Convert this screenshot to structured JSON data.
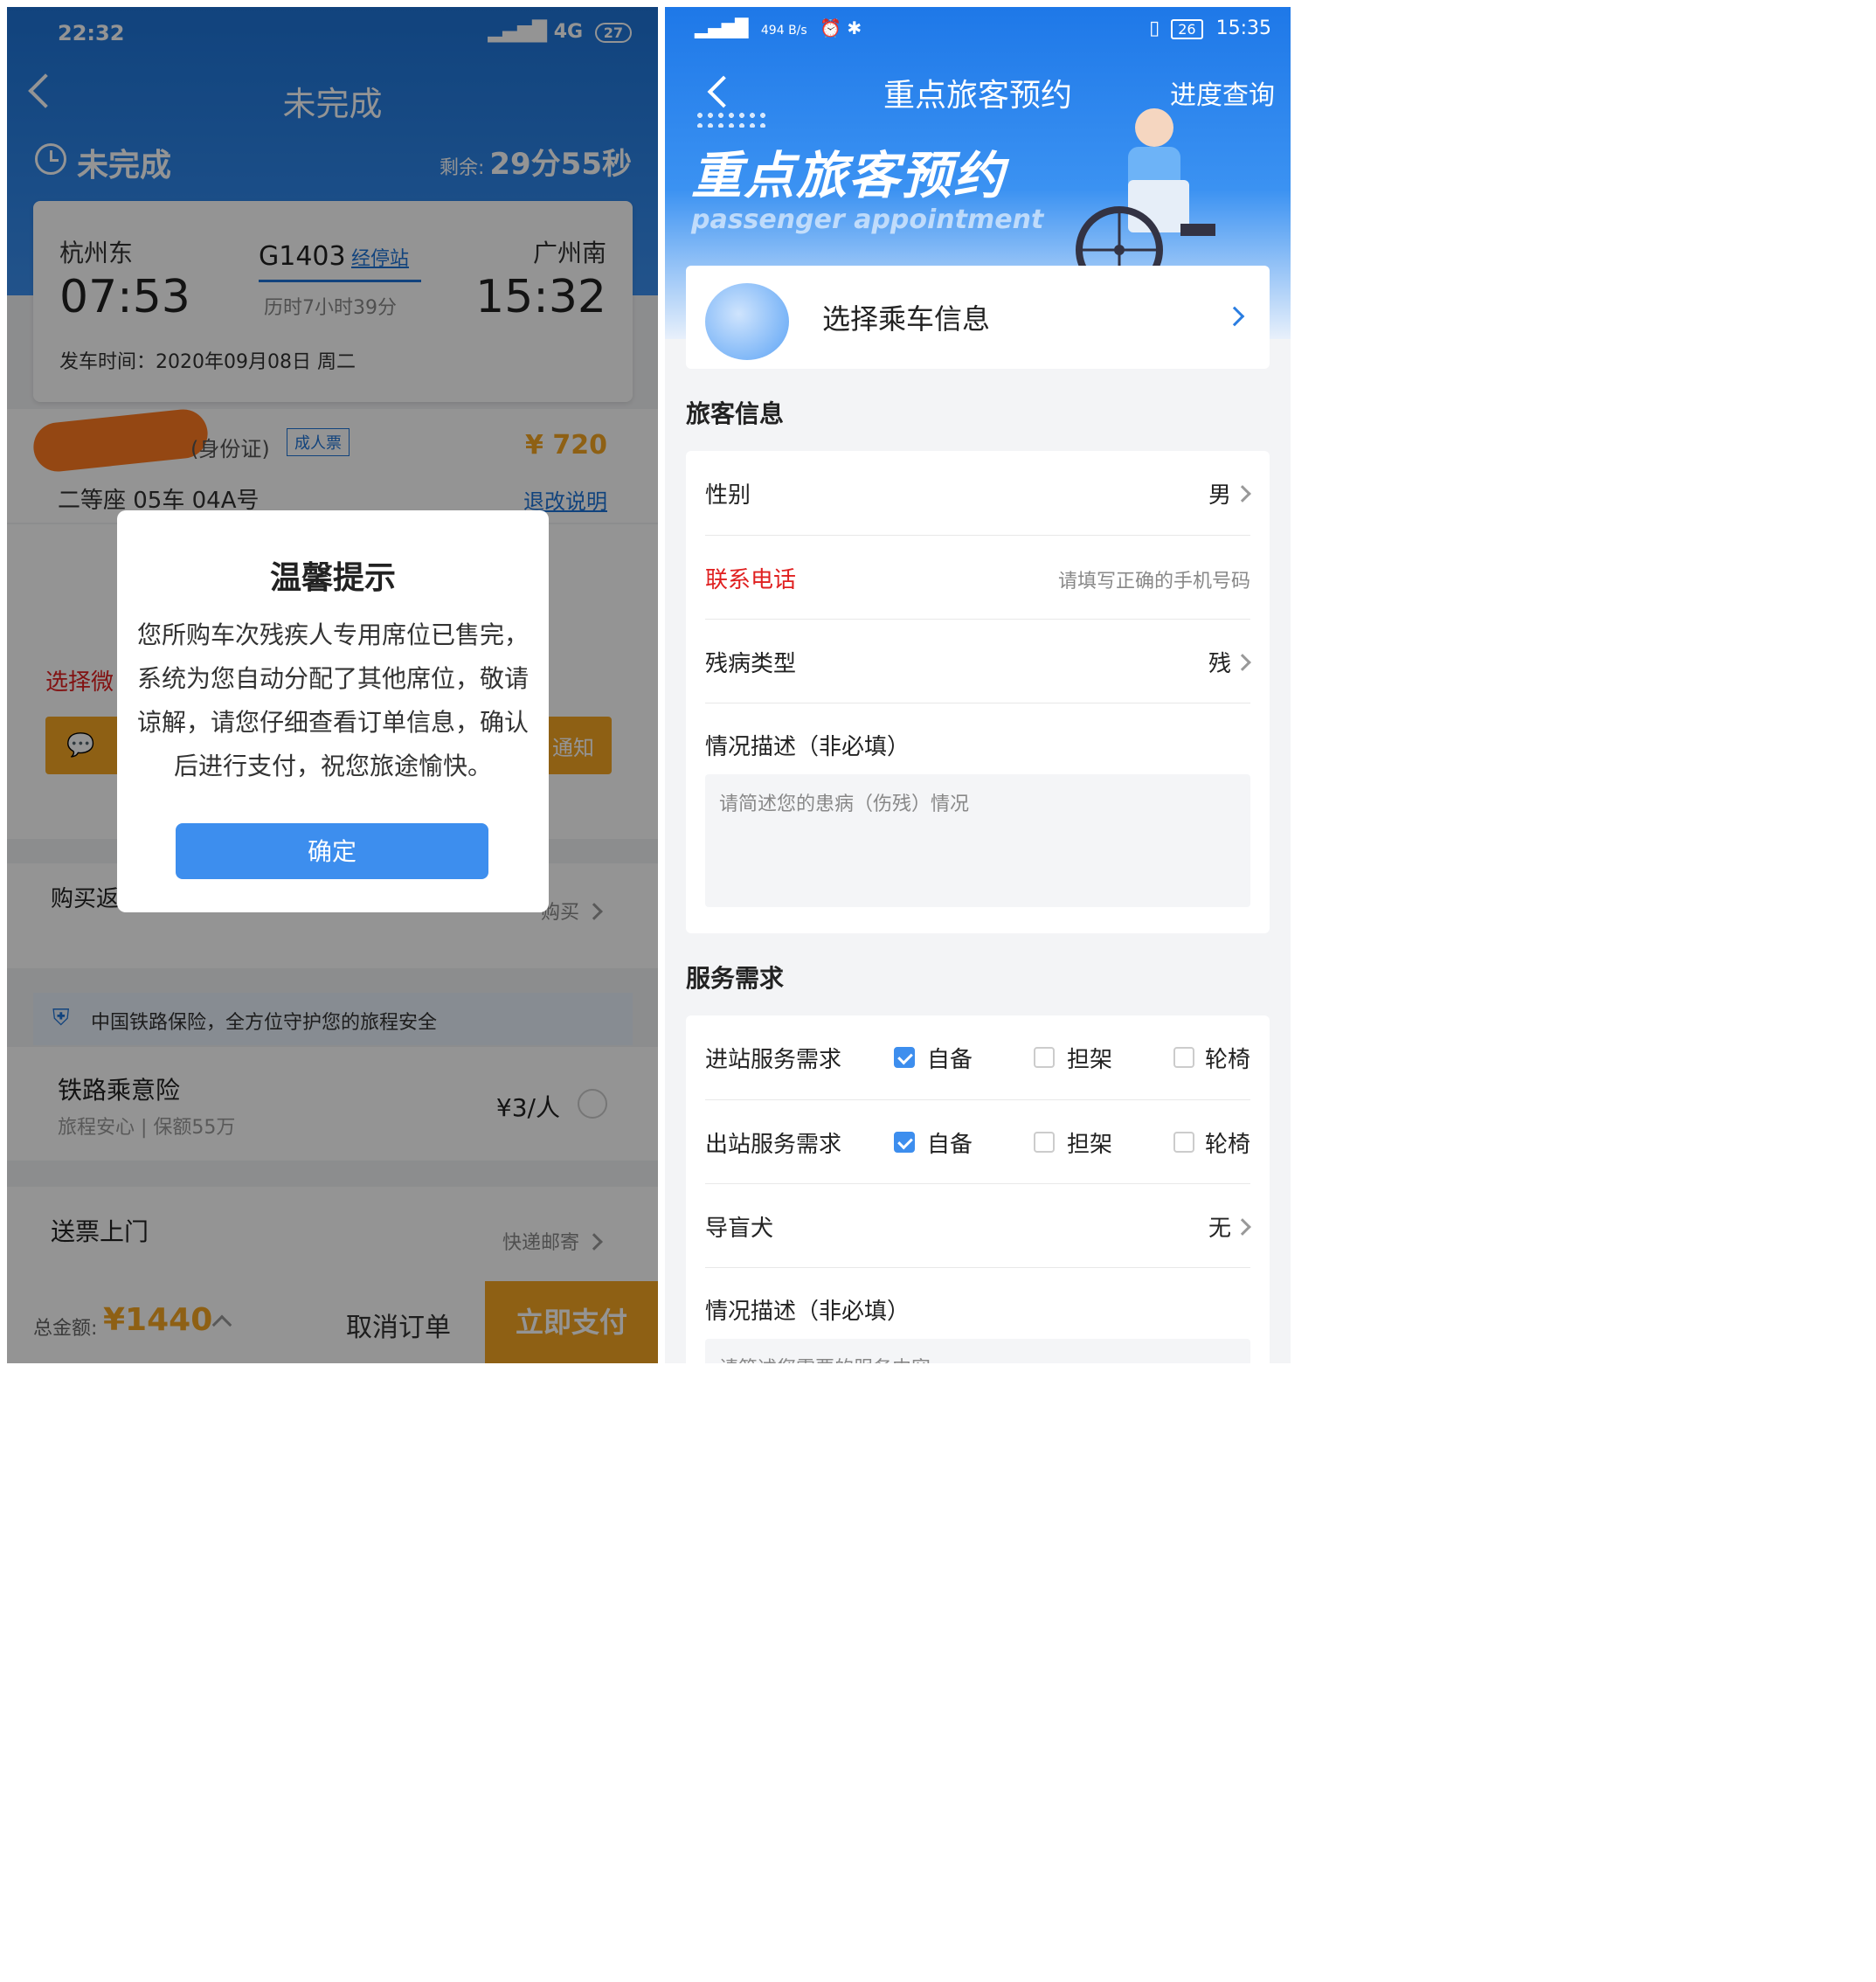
{
  "left": {
    "status_time": "22:32",
    "status_network": "4G",
    "status_battery": "27",
    "title": "未完成",
    "order_status": "未完成",
    "remain_label": "剩余:",
    "remain_value": "29分55秒",
    "trip": {
      "from": "杭州东",
      "depart_time": "07:53",
      "train_no": "G1403",
      "stops_link": "经停站",
      "duration": "历时7小时39分",
      "to": "广州南",
      "arrive_time": "15:32",
      "date_line": "发车时间：2020年09月08日 周二"
    },
    "passenger": {
      "id_type": "(身份证)",
      "ticket_type": "成人票",
      "price": "¥ 720",
      "seat": "二等座 05车 04A号",
      "refund_link": "退改说明"
    },
    "wechat_label": "选择微",
    "notify_label": "通知",
    "buy_return_label": "购买返",
    "buy_label": "购买",
    "insurance_banner": "中国铁路保险，全方位守护您的旅程安全",
    "insurance_name": "铁路乘意险",
    "insurance_desc": "旅程安心 | 保额55万",
    "insurance_price": "¥3/人",
    "delivery_label": "送票上门",
    "delivery_option": "快递邮寄",
    "total_label": "总金额:",
    "total_value": "¥1440",
    "cancel_label": "取消订单",
    "pay_label": "立即支付",
    "dialog": {
      "title": "温馨提示",
      "body": "您所购车次残疾人专用席位已售完，系统为您自动分配了其他席位，敬请谅解，请您仔细查看订单信息，确认后进行支付，祝您旅途愉快。",
      "confirm": "确定"
    },
    "colors": {
      "primary": "#1e74d8",
      "accent": "#f5a623",
      "price": "#f5a623",
      "warn": "#e02020"
    }
  },
  "right": {
    "status_speed": "494 B/s",
    "status_battery": "26",
    "status_time": "15:35",
    "title": "重点旅客预约",
    "progress_link": "进度查询",
    "banner_cn": "重点旅客预约",
    "banner_en": "passenger appointment",
    "select_train": "选择乘车信息",
    "section_passenger": "旅客信息",
    "gender_label": "性别",
    "gender_value": "男",
    "phone_label": "联系电话",
    "phone_placeholder": "请填写正确的手机号码",
    "disability_label": "残病类型",
    "disability_value": "残",
    "desc_label": "情况描述（非必填）",
    "desc_placeholder": "请简述您的患病（伤残）情况",
    "section_service": "服务需求",
    "entry_label": "进站服务需求",
    "exit_label": "出站服务需求",
    "options": [
      "自备",
      "担架",
      "轮椅"
    ],
    "entry_checked": [
      true,
      false,
      false
    ],
    "exit_checked": [
      true,
      false,
      false
    ],
    "guide_dog_label": "导盲犬",
    "guide_dog_value": "无",
    "service_desc_label": "情况描述（非必填）",
    "service_desc_placeholder": "请简述您需要的服务内容",
    "colors": {
      "primary": "#2a7de1",
      "required": "#e02020",
      "checkbox": "#3d8eee"
    }
  }
}
